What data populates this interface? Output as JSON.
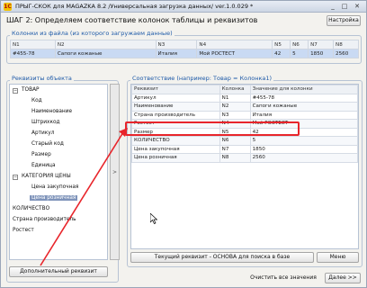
{
  "window": {
    "title": "ПРЫГ-СКОК для MAGAZKA 8.2 /Универсальная загрузка данных/ ver.1.0.029 *",
    "minimize": "_",
    "maximize": "□",
    "close": "✕"
  },
  "header": {
    "step_title": "ШАГ 2: Определяем соответствие колонок таблицы и реквизитов",
    "settings_button": "Настройка"
  },
  "file_columns": {
    "group_label": "Колонки из файла (из которого загружаем данные)",
    "headers": [
      "N1",
      "N2",
      "N3",
      "N4",
      "N5",
      "N6",
      "N7",
      "N8"
    ],
    "row": [
      "#455-78",
      "Сапоги кожаные",
      "Италия",
      "Мой РОСТЕСТ",
      "42",
      "5",
      "1850",
      "2560"
    ]
  },
  "object_attrs": {
    "group_label": "Реквизиты объекта",
    "tree": [
      {
        "label": "ТОВАР",
        "level": 0,
        "expanded": true
      },
      {
        "label": "Код",
        "level": 1
      },
      {
        "label": "Наименование",
        "level": 1
      },
      {
        "label": "Штрихкод",
        "level": 1
      },
      {
        "label": "Артикул",
        "level": 1
      },
      {
        "label": "Старый код",
        "level": 1
      },
      {
        "label": "Размер",
        "level": 1
      },
      {
        "label": "Единица",
        "level": 1
      },
      {
        "label": "КАТЕГОРИЯ ЦЕНЫ",
        "level": 0,
        "expanded": true
      },
      {
        "label": "Цена закупочная",
        "level": 1
      },
      {
        "label": "Цена розничная",
        "level": 1,
        "selected": true
      },
      {
        "label": "КОЛИЧЕСТВО",
        "level": 0
      },
      {
        "label": "Страна производитель",
        "level": 0
      },
      {
        "label": "Ростест",
        "level": 0
      }
    ],
    "add_button": "Дополнительный реквизит"
  },
  "mapping": {
    "group_label": "Соответствие (например: Товар = Колонка1)",
    "headers": [
      "Реквизит",
      "Колонка",
      "Значение для колонки"
    ],
    "rows": [
      [
        "Артикул",
        "N1",
        "#455-78"
      ],
      [
        "Наименование",
        "N2",
        "Сапоги кожаные"
      ],
      [
        "Страна производитель",
        "N3",
        "Италия"
      ],
      [
        "Ростест",
        "N4",
        "Мой РОСТЕСТ"
      ],
      [
        "Размер",
        "N5",
        "42"
      ],
      [
        "КОЛИЧЕСТВО",
        "N6",
        "5"
      ],
      [
        "Цена закупочная",
        "N7",
        "1850"
      ],
      [
        "Цена розничная",
        "N8",
        "2560"
      ]
    ],
    "current_button": "Текущий реквизит - ОСНОВА для поиска в базе",
    "menu_button": "Меню"
  },
  "arrow_button": ">",
  "footer": {
    "clear_button": "Очистить все значения",
    "next_button": "Далее >>"
  },
  "colors": {
    "accent_blue": "#1e5aa8",
    "highlight_red": "#e8252b",
    "selection": "#7f94ba",
    "row_selection": "#c9daf3"
  }
}
